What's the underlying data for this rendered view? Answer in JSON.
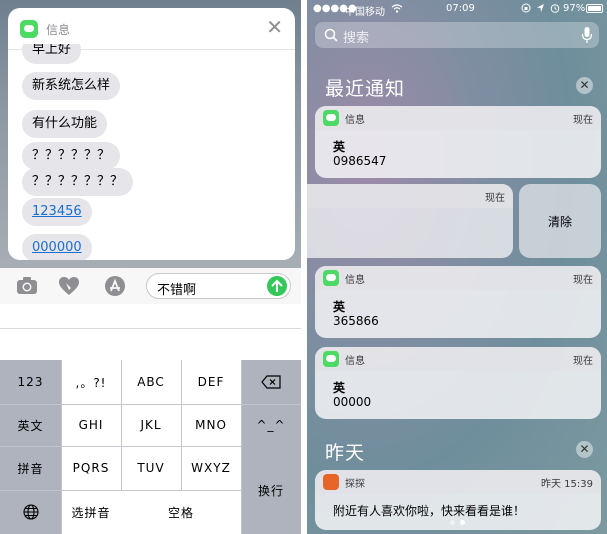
{
  "left": {
    "card": {
      "app_name": "信息",
      "close": "✕"
    },
    "messages": [
      {
        "text": "早上好",
        "link": false
      },
      {
        "text": "新系统怎么样",
        "link": false
      },
      {
        "text": "有什么功能",
        "link": false
      },
      {
        "text": "？？？？？？",
        "link": false
      },
      {
        "text": "？？？？？？？",
        "link": false
      },
      {
        "text": "123456",
        "link": true
      },
      {
        "text": "000000",
        "link": true
      }
    ],
    "compose": {
      "input_value": "不错啊"
    },
    "keyboard": {
      "left_col": [
        "123",
        "英文",
        "拼音"
      ],
      "row1": [
        ",。?!",
        "ABC",
        "DEF"
      ],
      "row2": [
        "GHI",
        "JKL",
        "MNO"
      ],
      "row3": [
        "PQRS",
        "TUV",
        "WXYZ"
      ],
      "bottom": {
        "pinyin_select": "选拼音",
        "space": "空格"
      },
      "right_keys": {
        "emoji": "^_^",
        "newline": "换行"
      }
    }
  },
  "right": {
    "status": {
      "carrier": "中国移动",
      "time": "07:09",
      "battery": "97%"
    },
    "search": {
      "placeholder": "搜索"
    },
    "recent": {
      "title": "最近通知",
      "close": "✕"
    },
    "cards": [
      {
        "app": "信息",
        "time": "现在",
        "sender": "英",
        "body": "0986547"
      },
      {
        "app": "信息",
        "time": "现在",
        "sender": "英",
        "body": "365866"
      },
      {
        "app": "信息",
        "time": "现在",
        "sender": "英",
        "body": "00000"
      }
    ],
    "swiped": {
      "time": "现在",
      "clear_label": "清除"
    },
    "yesterday": {
      "title": "昨天",
      "close": "✕"
    },
    "tantan": {
      "app": "探探",
      "time": "昨天 15:39",
      "body": "附近有人喜欢你啦，快来看看是谁！"
    }
  }
}
